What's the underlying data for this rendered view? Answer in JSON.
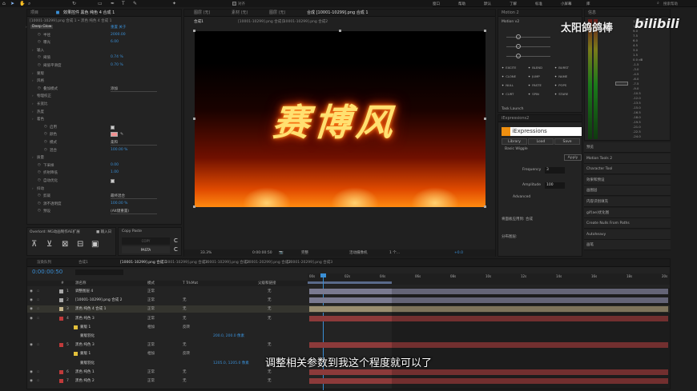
{
  "menu": [
    "窗口",
    "帮助",
    "默认",
    "了解",
    "标准",
    "小屏幕",
    "库"
  ],
  "menu_search": "搜索帮助",
  "effects_panel": {
    "tab_project": "项目",
    "tab_effects": "效果控件 黑色 纯色 4 合成 1",
    "breadcrumb": "[10001-10299].png 合成 1 • 黑色 纯色 4 合成 1",
    "rows": [
      {
        "label": "Deep Glow",
        "value": "重置  关于",
        "type": "fx"
      },
      {
        "label": "半径",
        "value": "2000.00",
        "type": "prop"
      },
      {
        "label": "曝光",
        "value": "6.00",
        "type": "prop"
      },
      {
        "label": "输入",
        "value": "",
        "type": "group"
      },
      {
        "label": "阈值",
        "value": "0.74 %",
        "type": "prop"
      },
      {
        "label": "阈值平滑度",
        "value": "0.70 %",
        "type": "prop"
      },
      {
        "label": "蒙版",
        "value": "",
        "type": "group"
      },
      {
        "label": "风格",
        "value": "",
        "type": "group"
      },
      {
        "label": "叠加模式",
        "value": "添加",
        "type": "dropdown"
      },
      {
        "label": "物理校正",
        "value": "",
        "type": "group"
      },
      {
        "label": "长宽比",
        "value": "",
        "type": "group"
      },
      {
        "label": "热度",
        "value": "",
        "type": "group"
      },
      {
        "label": "着色",
        "value": "",
        "type": "group"
      },
      {
        "label": "启用",
        "value": "",
        "type": "check"
      },
      {
        "label": "颜色",
        "value": "",
        "type": "color"
      },
      {
        "label": "模式",
        "value": "柔和",
        "type": "dropdown"
      },
      {
        "label": "混合",
        "value": "100.00 %",
        "type": "prop"
      },
      {
        "label": "质量",
        "value": "",
        "type": "group"
      },
      {
        "label": "下采样",
        "value": "0.00",
        "type": "prop"
      },
      {
        "label": "折射降低",
        "value": "1.00",
        "type": "prop"
      },
      {
        "label": "自动优化",
        "value": "",
        "type": "check"
      },
      {
        "label": "抖动",
        "value": "",
        "type": "group"
      },
      {
        "label": "剪裁",
        "value": "最终混合",
        "type": "dropdown"
      },
      {
        "label": "源不透明度",
        "value": "100.00 %",
        "type": "prop"
      },
      {
        "label": "预设",
        "value": "(Alt键重置)",
        "type": "dropdown"
      }
    ]
  },
  "overlord": {
    "title": "Overlord: MG动画制作AE扩展",
    "menu_icon": "≡",
    "links": "■ 输入日"
  },
  "copy_paste": {
    "title": "Copy Paste",
    "copy": "COPY",
    "paste": "PASTA"
  },
  "viewer": {
    "tabs": [
      "合成1",
      "[10001-10299].png 合成 1",
      "[10001-10299].png 合成2"
    ],
    "top_tabs": [
      "图层  (无)",
      "素材  (无)",
      "图层  (无)",
      "合成  [10001-10299].png 合成 1"
    ],
    "artwork_text": "赛博风",
    "zoom": "33.3%",
    "timecode": "0:00:00:50",
    "quality": "完整",
    "camera": "活动摄像机",
    "views": "1 个...",
    "exposure": "+0.0"
  },
  "motion2": {
    "title": "Motion 2",
    "preset": "Motion v2",
    "buttons": [
      "EXCITE",
      "BLEND",
      "BURST",
      "CLONE",
      "JUMP",
      "NAME",
      "NULL",
      "PASTE",
      "POPS",
      "CURT",
      "SPIN",
      "STARE"
    ],
    "task": "Task Launch"
  },
  "iexpr": {
    "title": "iExpressions2",
    "logo": "iExpressions",
    "tabs": [
      "Library",
      "Load",
      "Save"
    ],
    "section": "Basic Wiggle",
    "apply": "Apply",
    "freq_label": "Frequency",
    "freq_value": "3",
    "amp_label": "Amplitude",
    "amp_value": "100",
    "advanced": "Advanced",
    "comp_label": "将面板应用到: 合成",
    "align_label": "分布图层:"
  },
  "audio": {
    "title": "信息",
    "ticks": [
      "12.0 dB",
      "10.5",
      "9.0",
      "7.5",
      "6.0",
      "4.5",
      "3.0",
      "1.5",
      "0.0 dB",
      "-1.5",
      "-3.0",
      "-4.5",
      "-6.0",
      "-7.5",
      "-9.0",
      "-10.5",
      "-12.0",
      "-13.5",
      "-15.0",
      "-16.5",
      "-18.0",
      "-19.5",
      "-21.0",
      "-22.5",
      "-24.0"
    ]
  },
  "sidebar": {
    "items": [
      "预览",
      "Motion Tools 2",
      "Character Tool",
      "效果和预设",
      "画图层",
      "内容识别填充",
      "gif(ae)优化图",
      "Create Nulls From Paths",
      "Autoheavy",
      "画笔"
    ]
  },
  "watermark": {
    "author": "太阳鸽鸽棒",
    "brand": "bilibili"
  },
  "timeline": {
    "tabs": [
      "渲染队列",
      "合成1",
      "[10001-10299].png 合成 1",
      "[10001-10299].png 合成2",
      "[10001-10299].png 合成2",
      "[20001-20299].png 合成2",
      "[20001-20299].png 合成3"
    ],
    "timecode": "0:00:00:50",
    "headers": [
      "#",
      "源名称",
      "模式",
      "T TrkMat",
      "父级和链接"
    ],
    "ruler": [
      "00s",
      "02s",
      "04s",
      "06s",
      "08s",
      "10s",
      "12s",
      "14s",
      "16s",
      "18s",
      "20s"
    ],
    "layers": [
      {
        "num": "1",
        "name": "调整图层 4",
        "mode": "正常",
        "trk": "",
        "parent": "无",
        "color": "#a8a8a8",
        "bar": "#7a7a90"
      },
      {
        "num": "2",
        "name": "[10001-10299].png 合成 2",
        "mode": "正常",
        "trk": "无",
        "parent": "无",
        "color": "#a8a8a8",
        "bar": "#7a7a90"
      },
      {
        "num": "3",
        "name": "黑色 纯色 4 合成 1",
        "mode": "正常",
        "trk": "无",
        "parent": "无",
        "color": "#c4b48a",
        "bar": "#9a8e70"
      },
      {
        "num": "4",
        "name": "黑色 纯色 3",
        "mode": "正常",
        "trk": "无",
        "parent": "无",
        "color": "#c03a3a",
        "bar": "#8c3a3a"
      },
      {
        "num": "",
        "name": "蒙版 1",
        "mode": "相加",
        "trk": "反转",
        "parent": "",
        "color": "#e3c03a",
        "bar": ""
      },
      {
        "num": "",
        "name": "蒙版羽化",
        "mode": "",
        "trk": "",
        "parent": "",
        "color": "",
        "bar": "",
        "val": "200.0, 200.0 像素"
      },
      {
        "num": "5",
        "name": "黑色 纯色 3",
        "mode": "正常",
        "trk": "无",
        "parent": "无",
        "color": "#c03a3a",
        "bar": "#8c3a3a"
      },
      {
        "num": "",
        "name": "蒙版 1",
        "mode": "相加",
        "trk": "反转",
        "parent": "",
        "color": "#e3c03a",
        "bar": ""
      },
      {
        "num": "",
        "name": "蒙版羽化",
        "mode": "",
        "trk": "",
        "parent": "",
        "color": "",
        "bar": "",
        "val": "1205.0, 1205.0 像素"
      },
      {
        "num": "6",
        "name": "黑色 纯色 1",
        "mode": "正常",
        "trk": "无",
        "parent": "无",
        "color": "#c03a3a",
        "bar": "#8c3a3a"
      },
      {
        "num": "7",
        "name": "黑色 纯色 2",
        "mode": "正常",
        "trk": "无",
        "parent": "无",
        "color": "#c03a3a",
        "bar": "#8c3a3a"
      }
    ]
  },
  "subtitle": "调整相关参数到我这个程度就可以了",
  "colors": {
    "accent": "#3a8fd6",
    "orange": "#f0a030",
    "bg": "#1d1d1d"
  }
}
